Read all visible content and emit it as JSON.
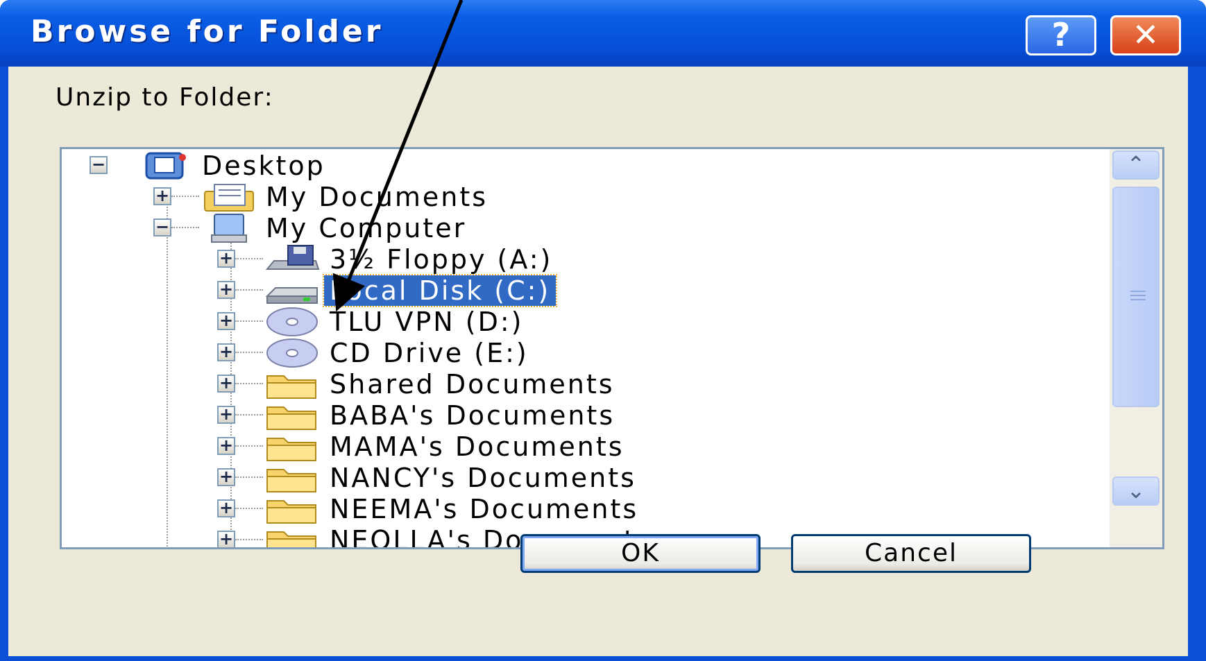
{
  "window": {
    "title": "Browse for Folder",
    "help_label": "?",
    "close_label": "✕"
  },
  "prompt": "Unzip to Folder:",
  "tree": {
    "items": [
      {
        "label": "Desktop",
        "expander": "−",
        "icon": "desktop-icon",
        "selected": false
      },
      {
        "label": "My Documents",
        "expander": "+",
        "icon": "my-documents-icon",
        "selected": false
      },
      {
        "label": "My Computer",
        "expander": "−",
        "icon": "my-computer-icon",
        "selected": false
      },
      {
        "label": "3½ Floppy (A:)",
        "expander": "+",
        "icon": "floppy-drive-icon",
        "selected": false
      },
      {
        "label": "Local Disk (C:)",
        "expander": "+",
        "icon": "hard-disk-icon",
        "selected": true
      },
      {
        "label": "TLU VPN (D:)",
        "expander": "+",
        "icon": "cd-drive-icon",
        "selected": false
      },
      {
        "label": "CD Drive (E:)",
        "expander": "+",
        "icon": "cd-drive-icon",
        "selected": false
      },
      {
        "label": "Shared Documents",
        "expander": "+",
        "icon": "folder-icon",
        "selected": false
      },
      {
        "label": "BABA's Documents",
        "expander": "+",
        "icon": "folder-icon",
        "selected": false
      },
      {
        "label": "MAMA's Documents",
        "expander": "+",
        "icon": "folder-icon",
        "selected": false
      },
      {
        "label": "NANCY's Documents",
        "expander": "+",
        "icon": "folder-icon",
        "selected": false
      },
      {
        "label": "NEEMA's Documents",
        "expander": "+",
        "icon": "folder-icon",
        "selected": false
      },
      {
        "label": "NEOLLA's Documents",
        "expander": "+",
        "icon": "folder-icon",
        "selected": false
      }
    ]
  },
  "scrollbar": {
    "up_label": "⌃",
    "down_label": "⌄"
  },
  "buttons": {
    "ok": "OK",
    "cancel": "Cancel"
  },
  "colors": {
    "title_bar": "#0550d8",
    "selection": "#316ac5",
    "client": "#ece9d8"
  }
}
